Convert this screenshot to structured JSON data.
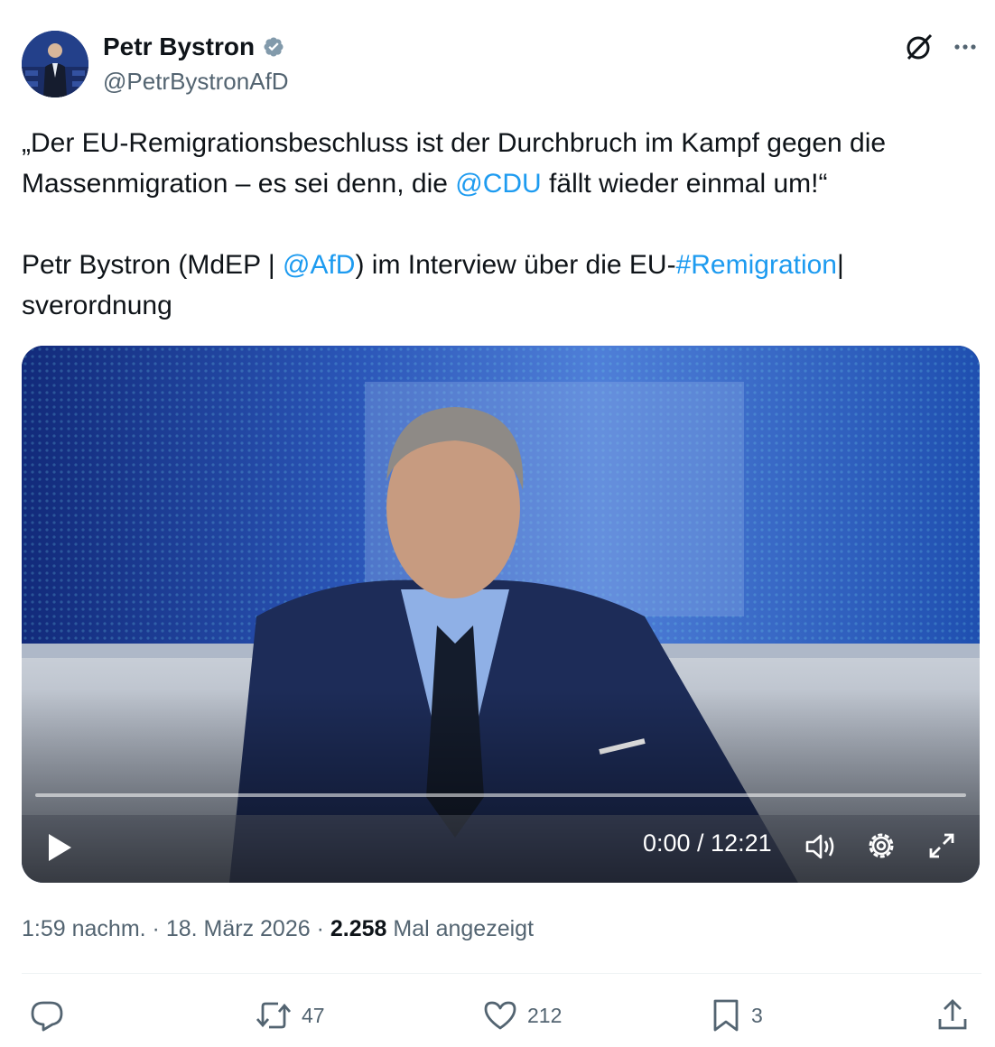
{
  "author": {
    "name": "Petr Bystron",
    "handle": "@PetrBystronAfD",
    "verified": true,
    "verified_color": "#829aab"
  },
  "tweet": {
    "line1_pre": "„Der EU-Remigrationsbeschluss ist der Durchbruch im Kampf gegen die Massenmigration – es sei denn, die ",
    "line1_mention": "@CDU",
    "line1_post": " fällt wieder einmal um!“",
    "line2_pre": "Petr Bystron (MdEP | ",
    "line2_mention": "@AfD",
    "line2_mid": ") im Interview über die EU-",
    "line2_hashtag": "#Remigration",
    "line2_post": "| sverordnung",
    "link_color": "#1d9bf0"
  },
  "video": {
    "time": "0:00 / 12:21",
    "controls": [
      "play-icon",
      "volume-icon",
      "settings-icon",
      "fullscreen-icon"
    ]
  },
  "meta": {
    "time": "1:59 nachm.",
    "sep1": " · ",
    "date": "18. März 2026",
    "sep2": " · ",
    "views_count": "2.258",
    "views_label": " Mal angezeigt"
  },
  "actions": {
    "reply_icon": "reply-icon",
    "retweets": "47",
    "likes": "212",
    "bookmarks": "3",
    "share_icon": "share-icon"
  },
  "header_icons": [
    "grok-icon",
    "more-icon"
  ]
}
